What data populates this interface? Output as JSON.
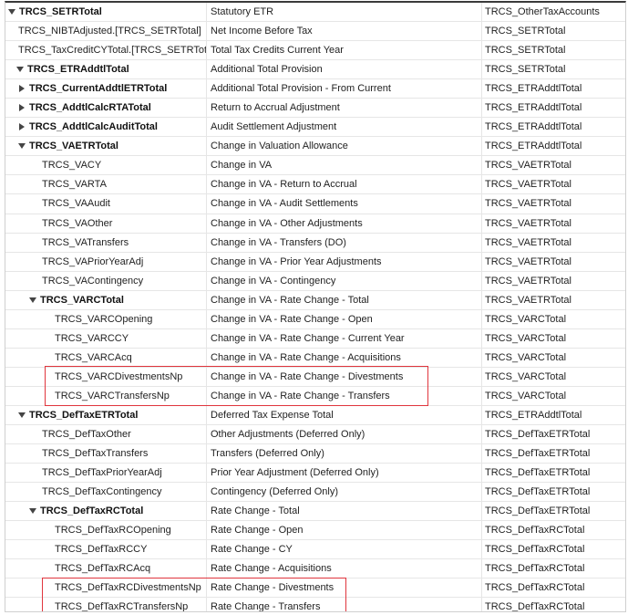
{
  "rows": [
    {
      "name": "TRCS_SETRTotal",
      "description": "Statutory ETR",
      "parent": "TRCS_OtherTaxAccounts",
      "level": 0,
      "toggle": "expanded",
      "bold": true
    },
    {
      "name": "TRCS_NIBTAdjusted.[TRCS_SETRTotal]",
      "description": "Net Income Before Tax",
      "parent": "TRCS_SETRTotal",
      "level": 1,
      "toggle": "none",
      "bold": false
    },
    {
      "name": "TRCS_TaxCreditCYTotal.[TRCS_SETRTotal]",
      "description": "Total Tax Credits Current Year",
      "parent": "TRCS_SETRTotal",
      "level": 1,
      "toggle": "none",
      "bold": false
    },
    {
      "name": "TRCS_ETRAddtlTotal",
      "description": "Additional Total Provision",
      "parent": "TRCS_SETRTotal",
      "level": 1,
      "toggle": "expanded",
      "bold": true
    },
    {
      "name": "TRCS_CurrentAddtlETRTotal",
      "description": "Additional Total Provision - From Current",
      "parent": "TRCS_ETRAddtlTotal",
      "level": 2,
      "toggle": "collapsed",
      "bold": true
    },
    {
      "name": "TRCS_AddtlCalcRTATotal",
      "description": "Return to Accrual Adjustment",
      "parent": "TRCS_ETRAddtlTotal",
      "level": 2,
      "toggle": "collapsed",
      "bold": true
    },
    {
      "name": "TRCS_AddtlCalcAuditTotal",
      "description": "Audit Settlement Adjustment",
      "parent": "TRCS_ETRAddtlTotal",
      "level": 2,
      "toggle": "collapsed",
      "bold": true
    },
    {
      "name": "TRCS_VAETRTotal",
      "description": "Change in Valuation Allowance",
      "parent": "TRCS_ETRAddtlTotal",
      "level": 2,
      "toggle": "expanded",
      "bold": true
    },
    {
      "name": "TRCS_VACY",
      "description": "Change in VA",
      "parent": "TRCS_VAETRTotal",
      "level": 3,
      "toggle": "none",
      "bold": false
    },
    {
      "name": "TRCS_VARTA",
      "description": "Change in VA - Return to Accrual",
      "parent": "TRCS_VAETRTotal",
      "level": 3,
      "toggle": "none",
      "bold": false
    },
    {
      "name": "TRCS_VAAudit",
      "description": "Change in VA - Audit Settlements",
      "parent": "TRCS_VAETRTotal",
      "level": 3,
      "toggle": "none",
      "bold": false
    },
    {
      "name": "TRCS_VAOther",
      "description": "Change in VA - Other Adjustments",
      "parent": "TRCS_VAETRTotal",
      "level": 3,
      "toggle": "none",
      "bold": false
    },
    {
      "name": "TRCS_VATransfers",
      "description": "Change in VA - Transfers (DO)",
      "parent": "TRCS_VAETRTotal",
      "level": 3,
      "toggle": "none",
      "bold": false
    },
    {
      "name": "TRCS_VAPriorYearAdj",
      "description": "Change in VA - Prior Year Adjustments",
      "parent": "TRCS_VAETRTotal",
      "level": 3,
      "toggle": "none",
      "bold": false
    },
    {
      "name": "TRCS_VAContingency",
      "description": "Change in VA - Contingency",
      "parent": "TRCS_VAETRTotal",
      "level": 3,
      "toggle": "none",
      "bold": false
    },
    {
      "name": "TRCS_VARCTotal",
      "description": "Change in VA - Rate Change - Total",
      "parent": "TRCS_VAETRTotal",
      "level": 3,
      "toggle": "expanded",
      "bold": true
    },
    {
      "name": "TRCS_VARCOpening",
      "description": "Change in VA - Rate Change - Open",
      "parent": "TRCS_VARCTotal",
      "level": 4,
      "toggle": "none",
      "bold": false
    },
    {
      "name": "TRCS_VARCCY",
      "description": "Change in VA - Rate Change - Current Year",
      "parent": "TRCS_VARCTotal",
      "level": 4,
      "toggle": "none",
      "bold": false
    },
    {
      "name": "TRCS_VARCAcq",
      "description": "Change in VA - Rate Change - Acquisitions",
      "parent": "TRCS_VARCTotal",
      "level": 4,
      "toggle": "none",
      "bold": false
    },
    {
      "name": "TRCS_VARCDivestmentsNp",
      "description": "Change in VA - Rate Change - Divestments",
      "parent": "TRCS_VARCTotal",
      "level": 4,
      "toggle": "none",
      "bold": false
    },
    {
      "name": "TRCS_VARCTransfersNp",
      "description": "Change in VA - Rate Change - Transfers",
      "parent": "TRCS_VARCTotal",
      "level": 4,
      "toggle": "none",
      "bold": false
    },
    {
      "name": "TRCS_DefTaxETRTotal",
      "description": "Deferred Tax Expense Total",
      "parent": "TRCS_ETRAddtlTotal",
      "level": 2,
      "toggle": "expanded",
      "bold": true
    },
    {
      "name": "TRCS_DefTaxOther",
      "description": "Other Adjustments (Deferred Only)",
      "parent": "TRCS_DefTaxETRTotal",
      "level": 3,
      "toggle": "none",
      "bold": false
    },
    {
      "name": "TRCS_DefTaxTransfers",
      "description": "Transfers (Deferred Only)",
      "parent": "TRCS_DefTaxETRTotal",
      "level": 3,
      "toggle": "none",
      "bold": false
    },
    {
      "name": "TRCS_DefTaxPriorYearAdj",
      "description": "Prior Year Adjustment (Deferred Only)",
      "parent": "TRCS_DefTaxETRTotal",
      "level": 3,
      "toggle": "none",
      "bold": false
    },
    {
      "name": "TRCS_DefTaxContingency",
      "description": "Contingency (Deferred Only)",
      "parent": "TRCS_DefTaxETRTotal",
      "level": 3,
      "toggle": "none",
      "bold": false
    },
    {
      "name": "TRCS_DefTaxRCTotal",
      "description": "Rate Change - Total",
      "parent": "TRCS_DefTaxETRTotal",
      "level": 3,
      "toggle": "expanded",
      "bold": true
    },
    {
      "name": "TRCS_DefTaxRCOpening",
      "description": "Rate Change - Open",
      "parent": "TRCS_DefTaxRCTotal",
      "level": 4,
      "toggle": "none",
      "bold": false
    },
    {
      "name": "TRCS_DefTaxRCCY",
      "description": "Rate Change - CY",
      "parent": "TRCS_DefTaxRCTotal",
      "level": 4,
      "toggle": "none",
      "bold": false
    },
    {
      "name": "TRCS_DefTaxRCAcq",
      "description": "Rate Change - Acquisitions",
      "parent": "TRCS_DefTaxRCTotal",
      "level": 4,
      "toggle": "none",
      "bold": false
    },
    {
      "name": "TRCS_DefTaxRCDivestmentsNp",
      "description": "Rate Change - Divestments",
      "parent": "TRCS_DefTaxRCTotal",
      "level": 4,
      "toggle": "none",
      "bold": false
    },
    {
      "name": "TRCS_DefTaxRCTransfersNp",
      "description": "Rate Change - Transfers",
      "parent": "TRCS_DefTaxRCTotal",
      "level": 4,
      "toggle": "none",
      "bold": false
    }
  ],
  "highlight_color": "#e0353d"
}
